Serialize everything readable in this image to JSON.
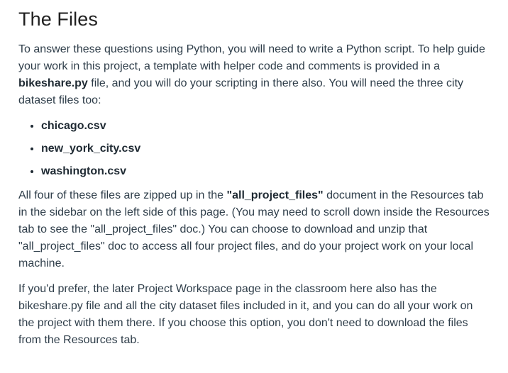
{
  "heading": "The Files",
  "intro": {
    "text1": "To answer these questions using Python, you will need to write a Python script. To help guide your work in this project, a template with helper code and comments is provided in a ",
    "bold1": "bikeshare.py",
    "text2": " file, and you will do your scripting in there also. You will need the three city dataset files too:"
  },
  "files": [
    "chicago.csv",
    "new_york_city.csv",
    "washington.csv"
  ],
  "para2": {
    "text1": "All four of these files are zipped up in the ",
    "bold1": "\"all_project_files\"",
    "text2": " document in the Resources tab in the sidebar on the left side of this page. (You may need to scroll down inside the Resources tab to see the \"all_project_files\" doc.) You can choose to download and unzip that \"all_project_files\" doc to access all four project files, and do your project work on your local machine."
  },
  "para3": {
    "text": "If you'd prefer, the later Project Workspace page in the classroom here also has the bikeshare.py file and all the city dataset files included in it, and you can do all your work on the project with them there. If you choose this option, you don't need to download the files from the Resources tab."
  }
}
